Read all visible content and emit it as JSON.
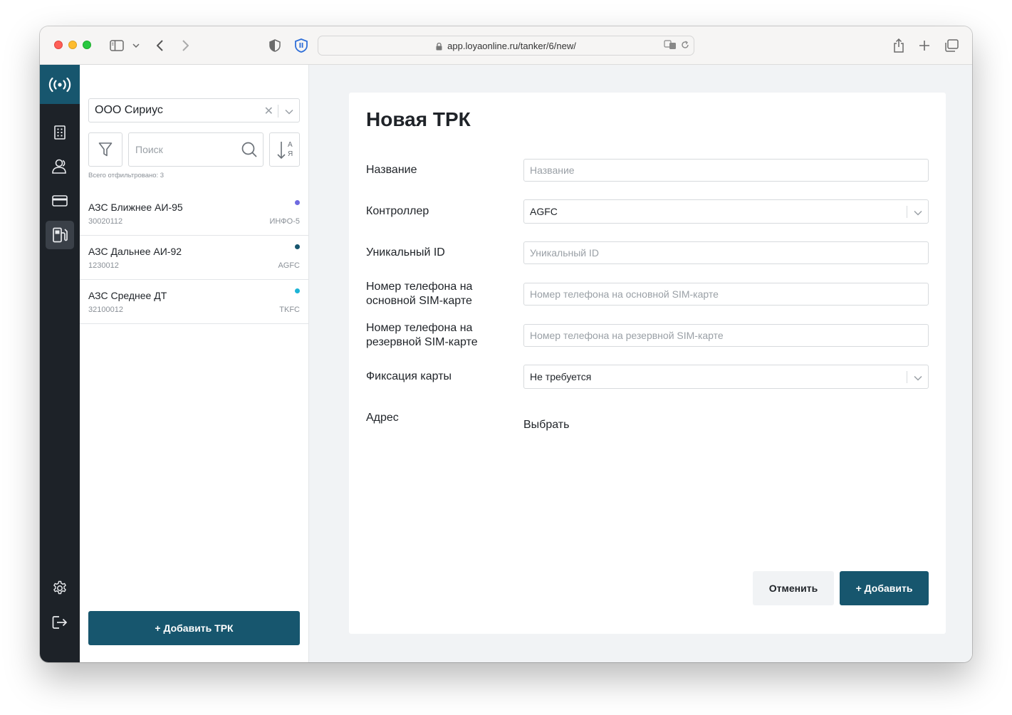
{
  "browser": {
    "url": "app.loyaonline.ru/tanker/6/new/"
  },
  "sidebar": {
    "organization": "ООО Сириус",
    "search_placeholder": "Поиск",
    "sort_top": "А",
    "sort_bottom": "Я",
    "filtered_count": "Всего отфильтровано: 3",
    "stations": [
      {
        "name": "АЗС Ближнее АИ-95",
        "code": "30020112",
        "type": "ИНФО-5",
        "dot_color": "#6e6ae0"
      },
      {
        "name": "АЗС Дальнее АИ-92",
        "code": "1230012",
        "type": "AGFC",
        "dot_color": "#17566e"
      },
      {
        "name": "АЗС Среднее ДТ",
        "code": "32100012",
        "type": "TKFC",
        "dot_color": "#1cb4d6"
      }
    ],
    "add_button": "+ Добавить ТРК"
  },
  "form": {
    "title": "Новая ТРК",
    "name_label": "Название",
    "name_placeholder": "Название",
    "controller_label": "Контроллер",
    "controller_value": "AGFC",
    "uid_label": "Уникальный ID",
    "uid_placeholder": "Уникальный ID",
    "phone_main_label": "Номер телефона на основной SIM-карте",
    "phone_main_placeholder": "Номер телефона на основной SIM-карте",
    "phone_backup_label": "Номер телефона на резервной SIM-карте",
    "phone_backup_placeholder": "Номер телефона на резервной SIM-карте",
    "card_fix_label": "Фиксация карты",
    "card_fix_value": "Не требуется",
    "address_label": "Адрес",
    "address_action": "Выбрать",
    "cancel_button": "Отменить",
    "submit_button": "+ Добавить"
  },
  "colors": {
    "brand": "#17566e",
    "rail": "#1d2228",
    "main_bg": "#f1f3f5"
  }
}
